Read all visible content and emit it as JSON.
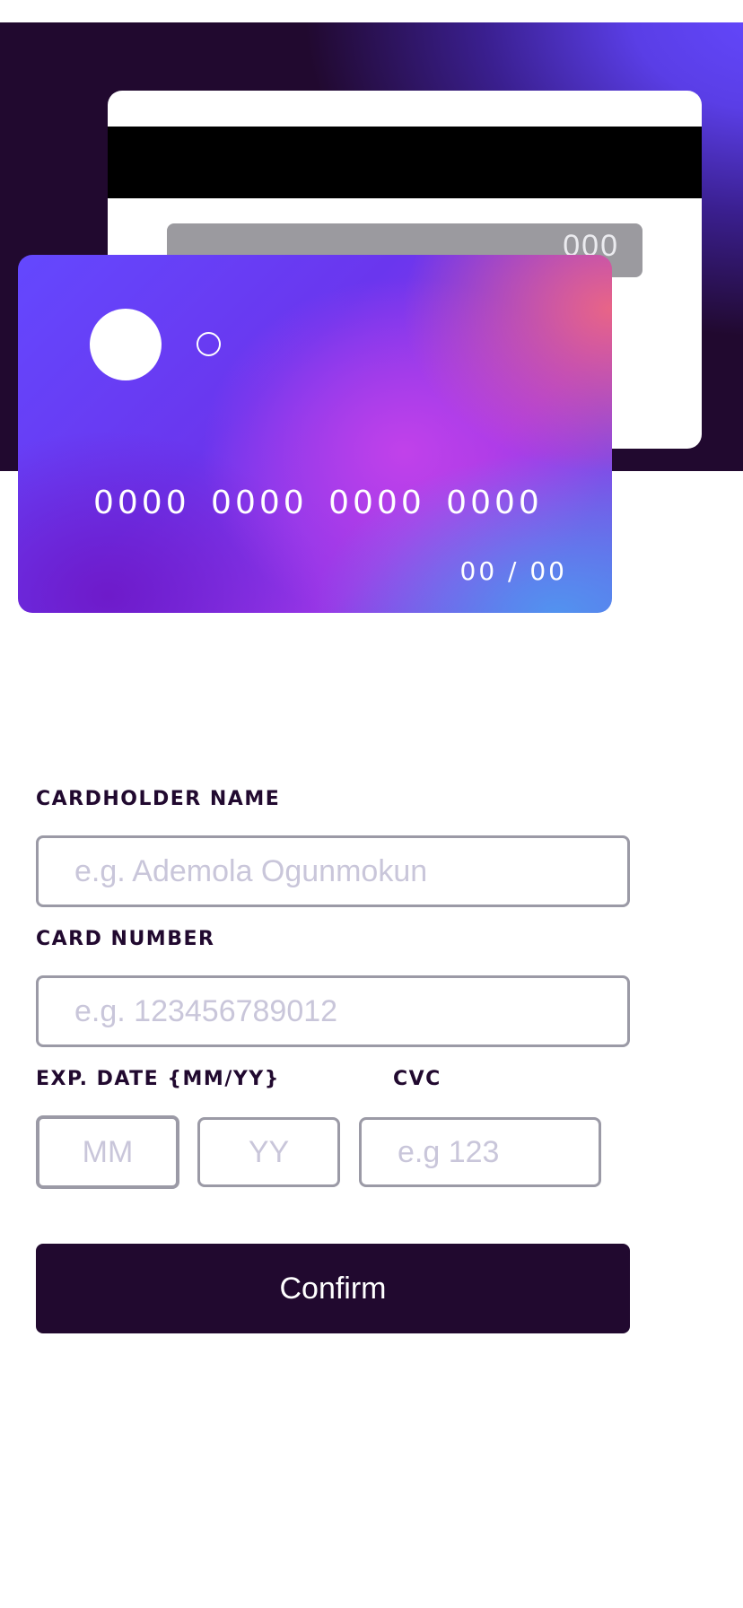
{
  "card_preview": {
    "back": {
      "cvc": "000"
    },
    "front": {
      "number": "0000 0000 0000 0000",
      "expiry": "00 / 00"
    }
  },
  "form": {
    "cardholder": {
      "label": "CARDHOLDER NAME",
      "placeholder": "e.g. Ademola Ogunmokun"
    },
    "card_number": {
      "label": "CARD NUMBER",
      "placeholder": "e.g. 123456789012"
    },
    "exp_date": {
      "label": "EXP. DATE {MM/YY}",
      "month_placeholder": "MM",
      "year_placeholder": "YY"
    },
    "cvc": {
      "label": "CVC",
      "placeholder": "e.g 123"
    },
    "confirm_label": "Confirm"
  },
  "colors": {
    "dark_violet": "#21092f",
    "gradient_start": "#6448fe",
    "input_border": "#9b9aa6",
    "placeholder": "#c9c6da"
  }
}
